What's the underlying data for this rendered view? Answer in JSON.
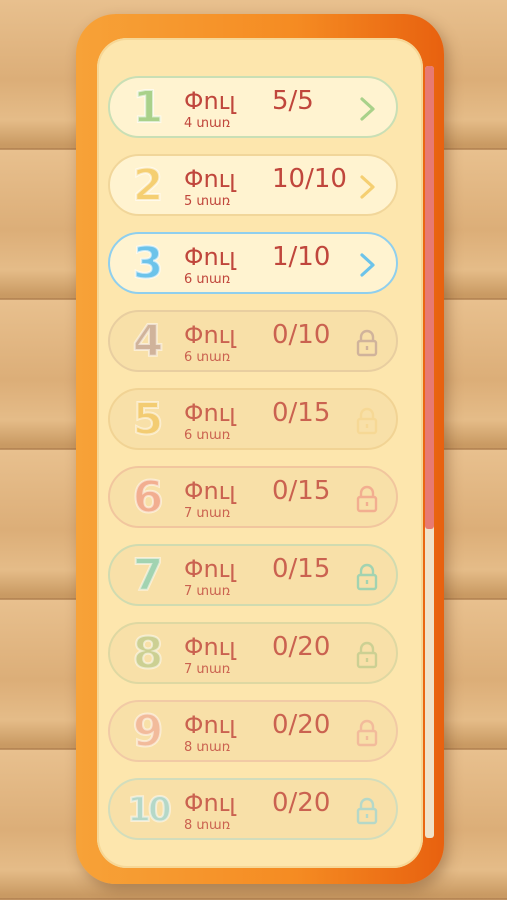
{
  "levels": [
    {
      "number": "1",
      "label": "Փուլ",
      "progress": "5/5",
      "sub": "4 տառ",
      "state": "arrow",
      "color": "#a9d18a",
      "border": "#c9dfb5"
    },
    {
      "number": "2",
      "label": "Փուլ",
      "progress": "10/10",
      "sub": "5 տառ",
      "state": "arrow",
      "color": "#f5cf72",
      "border": "#f1d69a"
    },
    {
      "number": "3",
      "label": "Փուլ",
      "progress": "1/10",
      "sub": "6 տառ",
      "state": "arrow",
      "color": "#6cc3ea",
      "border": "#8fcfee"
    },
    {
      "number": "4",
      "label": "Փուլ",
      "progress": "0/10",
      "sub": "6 տառ",
      "state": "lock",
      "color": "#c7a898",
      "border": "#e4c99e"
    },
    {
      "number": "5",
      "label": "Փուլ",
      "progress": "0/15",
      "sub": "6 տառ",
      "state": "lock",
      "color": "#f2c766",
      "border": "#efd08f"
    },
    {
      "number": "6",
      "label": "Փուլ",
      "progress": "0/15",
      "sub": "7 տառ",
      "state": "lock",
      "color": "#f0a28a",
      "border": "#efc09b"
    },
    {
      "number": "7",
      "label": "Փուլ",
      "progress": "0/15",
      "sub": "7 տառ",
      "state": "lock",
      "color": "#8fcfb2",
      "border": "#c7d9b1"
    },
    {
      "number": "8",
      "label": "Փուլ",
      "progress": "0/20",
      "sub": "7 տառ",
      "state": "lock",
      "color": "#c2cc8e",
      "border": "#d8d5a0"
    },
    {
      "number": "9",
      "label": "Փուլ",
      "progress": "0/20",
      "sub": "8 տառ",
      "state": "lock",
      "color": "#f0b298",
      "border": "#efc5a4"
    },
    {
      "number": "10",
      "label": "Փուլ",
      "progress": "0/20",
      "sub": "8 տառ",
      "state": "lock",
      "color": "#a6d5cf",
      "border": "#c9dcc0"
    }
  ],
  "scroll_position": 0.6
}
